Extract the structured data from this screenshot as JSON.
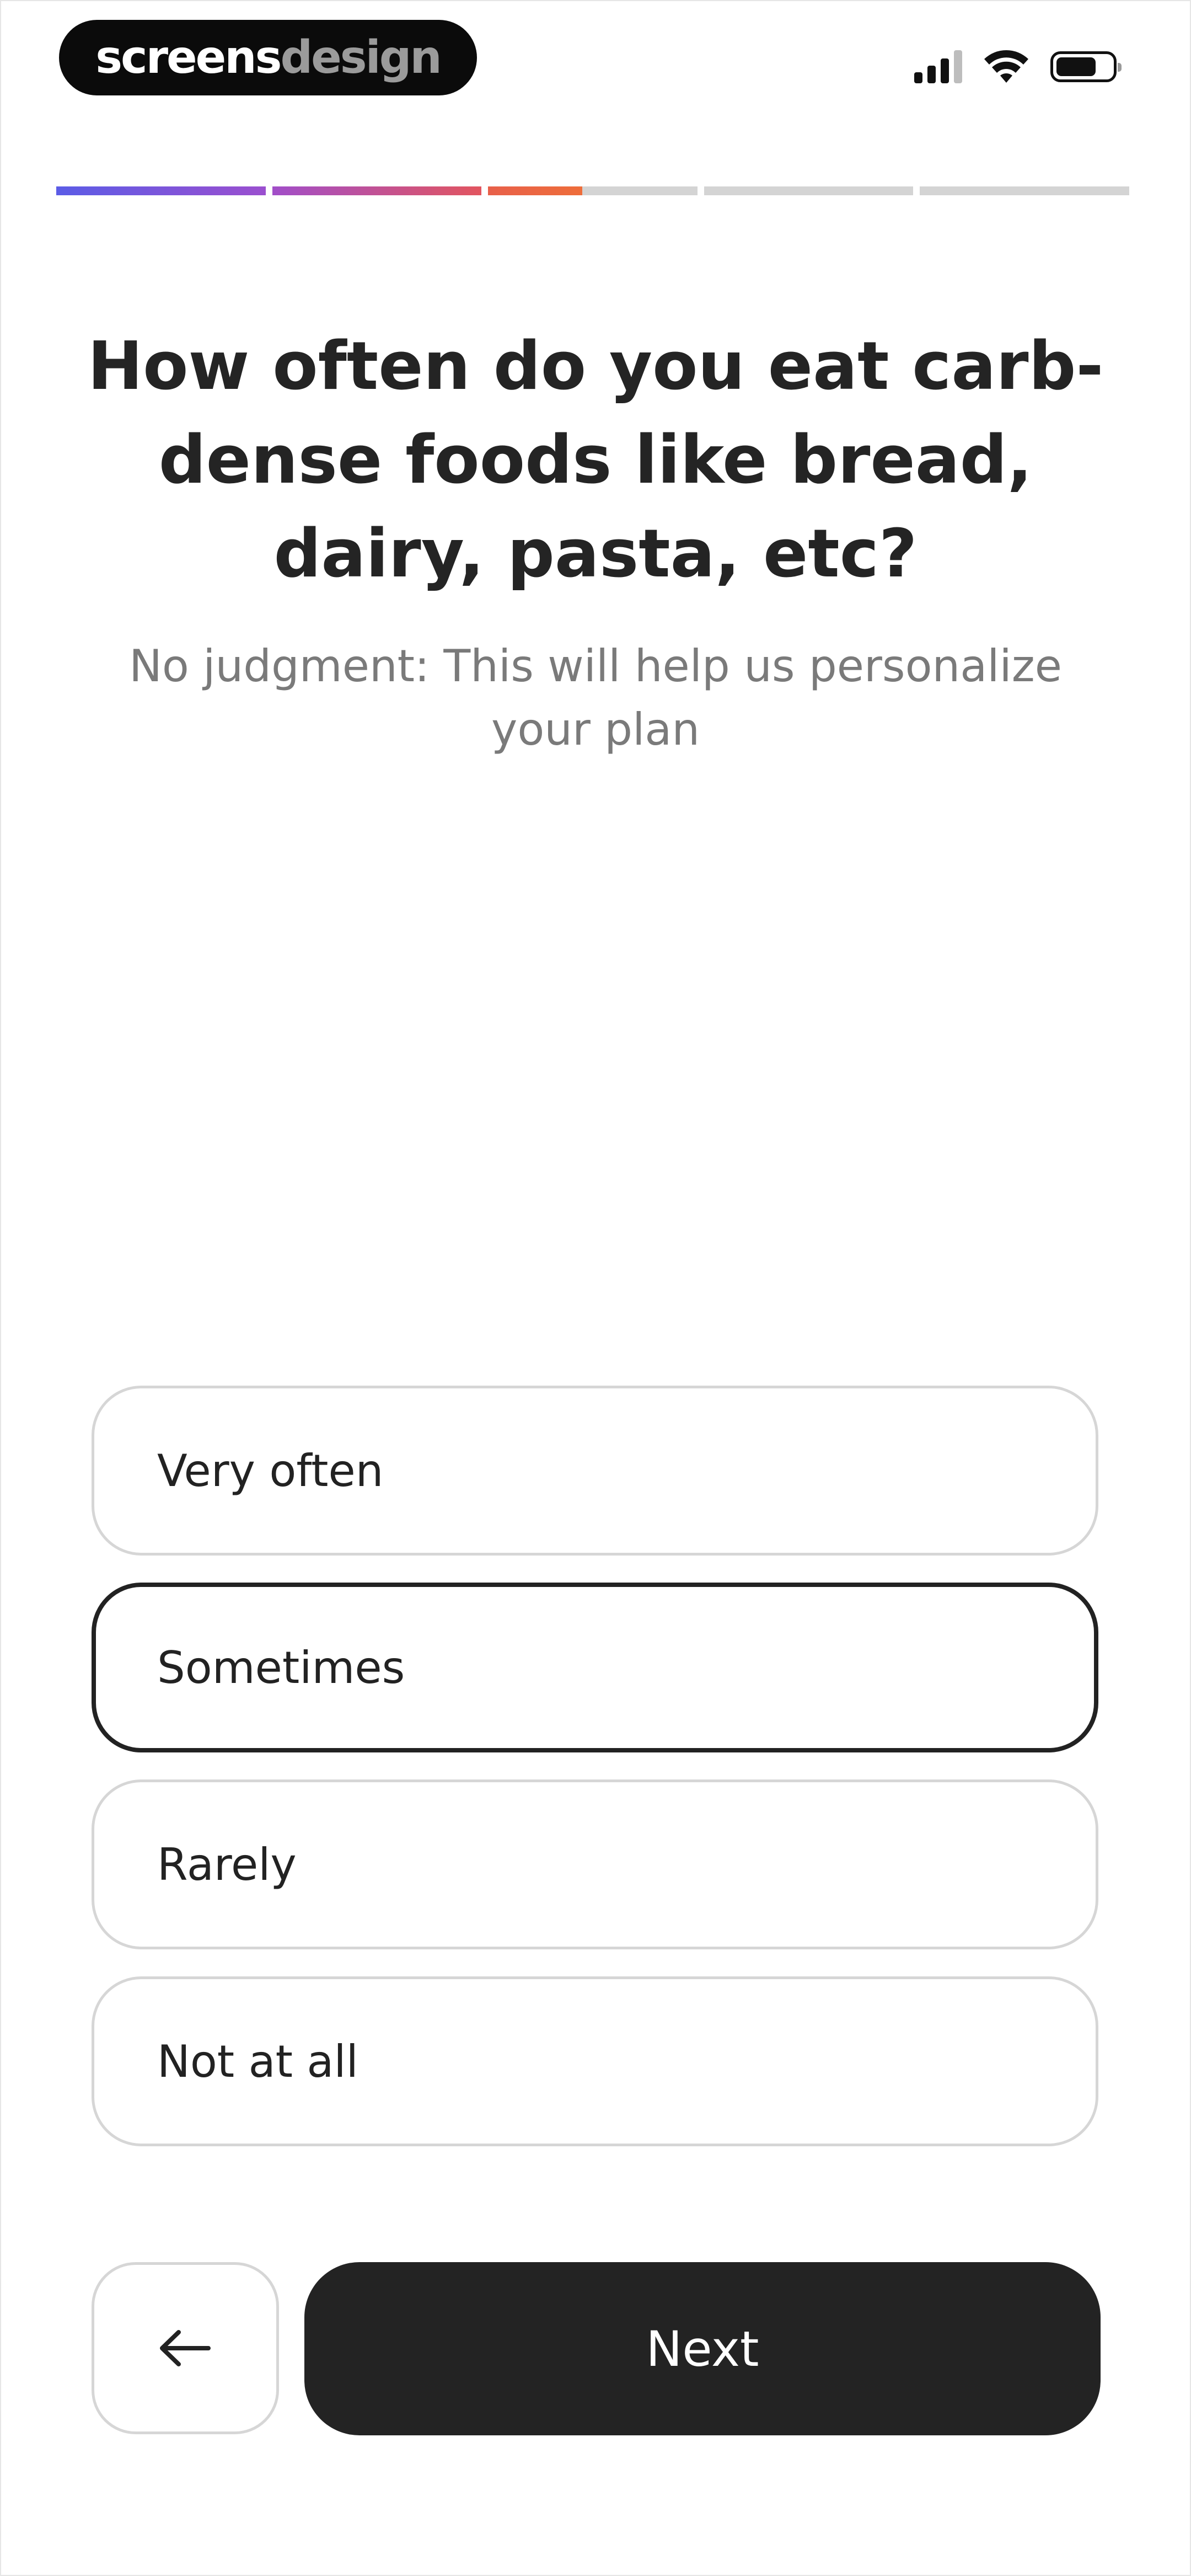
{
  "status_bar": {
    "brand_part1": "screens",
    "brand_part2": "design",
    "icons": [
      "cellular-signal-icon",
      "wifi-icon",
      "battery-icon"
    ]
  },
  "progress": {
    "segments": [
      {
        "fill": 1.0,
        "colors": [
          "#5b5ce6",
          "#9b4fcf"
        ]
      },
      {
        "fill": 1.0,
        "colors": [
          "#a14ec9",
          "#e2555f"
        ]
      },
      {
        "fill": 0.45,
        "colors": [
          "#e8604a",
          "#ee6d3a"
        ]
      },
      {
        "fill": 0.0,
        "colors": [
          "#d4d4d4",
          "#d4d4d4"
        ]
      },
      {
        "fill": 0.0,
        "colors": [
          "#d4d4d4",
          "#d4d4d4"
        ]
      }
    ],
    "track_color": "#d4d4d4"
  },
  "question": {
    "title": "How often do you eat carb-dense foods like bread, dairy, pasta, etc?",
    "subtitle": "No judgment: This will help us personalize your plan"
  },
  "options": [
    {
      "label": "Very often",
      "selected": false
    },
    {
      "label": "Sometimes",
      "selected": true
    },
    {
      "label": "Rarely",
      "selected": false
    },
    {
      "label": "Not at all",
      "selected": false
    }
  ],
  "nav": {
    "back_icon": "arrow-left-icon",
    "next_label": "Next"
  },
  "colors": {
    "primary": "#232323",
    "option_border": "#d6d6d6",
    "subtitle": "#7a7a7a"
  }
}
